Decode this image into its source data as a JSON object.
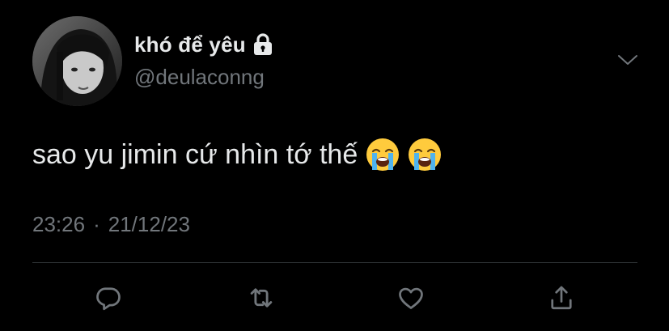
{
  "user": {
    "display_name": "khó để yêu",
    "handle": "@deulaconng",
    "protected_icon": "lock-icon",
    "avatar": "profile-avatar"
  },
  "tweet": {
    "text": "sao yu jimin cứ nhìn tớ thế",
    "emojis": [
      "loudly-crying-face",
      "loudly-crying-face"
    ],
    "time": "23:26",
    "separator": "·",
    "date": "21/12/23"
  },
  "actions": [
    {
      "name": "reply",
      "icon": "reply-icon"
    },
    {
      "name": "retweet",
      "icon": "retweet-icon"
    },
    {
      "name": "like",
      "icon": "heart-icon"
    },
    {
      "name": "share",
      "icon": "share-icon"
    }
  ],
  "colors": {
    "background": "#000000",
    "primary_text": "#e7e9ea",
    "secondary_text": "#71767b",
    "divider": "#2f3336"
  }
}
